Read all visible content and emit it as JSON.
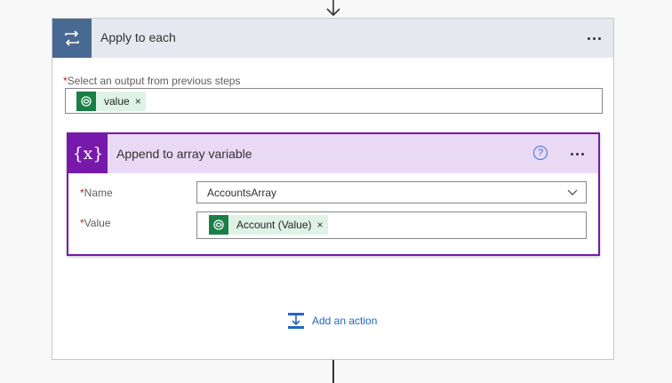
{
  "foreach": {
    "title": "Apply to each",
    "select_label": "Select an output from previous steps",
    "required_marker": "*",
    "token": {
      "label": "value",
      "remove": "×"
    }
  },
  "append": {
    "title": "Append to array variable",
    "help": "?",
    "icon_text": "{x}",
    "fields": {
      "name_label": "Name",
      "name_value": "AccountsArray",
      "value_label": "Value",
      "value_token": "Account (Value)",
      "remove": "×"
    }
  },
  "add_action": {
    "label": "Add an action"
  },
  "colors": {
    "foreach_accent": "#486991",
    "foreach_header": "#e6e8f0",
    "append_accent": "#7719aa",
    "append_header": "#ead9f5",
    "token_bg": "#dff2e6",
    "token_icon": "#1a7f47",
    "link": "#2266c4"
  }
}
